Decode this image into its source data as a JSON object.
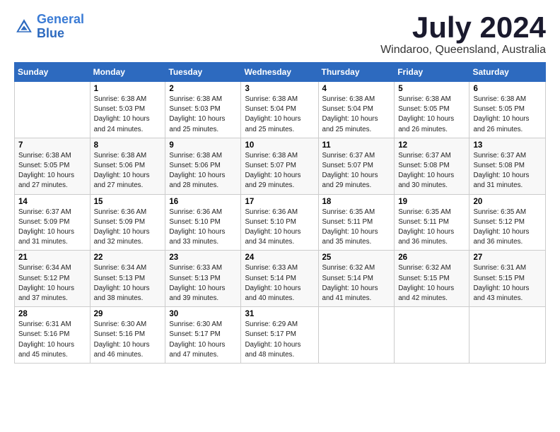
{
  "logo": {
    "text_general": "General",
    "text_blue": "Blue"
  },
  "header": {
    "title": "July 2024",
    "subtitle": "Windaroo, Queensland, Australia"
  },
  "days_of_week": [
    "Sunday",
    "Monday",
    "Tuesday",
    "Wednesday",
    "Thursday",
    "Friday",
    "Saturday"
  ],
  "weeks": [
    [
      {
        "day": "",
        "info": ""
      },
      {
        "day": "1",
        "info": "Sunrise: 6:38 AM\nSunset: 5:03 PM\nDaylight: 10 hours\nand 24 minutes."
      },
      {
        "day": "2",
        "info": "Sunrise: 6:38 AM\nSunset: 5:03 PM\nDaylight: 10 hours\nand 25 minutes."
      },
      {
        "day": "3",
        "info": "Sunrise: 6:38 AM\nSunset: 5:04 PM\nDaylight: 10 hours\nand 25 minutes."
      },
      {
        "day": "4",
        "info": "Sunrise: 6:38 AM\nSunset: 5:04 PM\nDaylight: 10 hours\nand 25 minutes."
      },
      {
        "day": "5",
        "info": "Sunrise: 6:38 AM\nSunset: 5:05 PM\nDaylight: 10 hours\nand 26 minutes."
      },
      {
        "day": "6",
        "info": "Sunrise: 6:38 AM\nSunset: 5:05 PM\nDaylight: 10 hours\nand 26 minutes."
      }
    ],
    [
      {
        "day": "7",
        "info": "Sunrise: 6:38 AM\nSunset: 5:05 PM\nDaylight: 10 hours\nand 27 minutes."
      },
      {
        "day": "8",
        "info": "Sunrise: 6:38 AM\nSunset: 5:06 PM\nDaylight: 10 hours\nand 27 minutes."
      },
      {
        "day": "9",
        "info": "Sunrise: 6:38 AM\nSunset: 5:06 PM\nDaylight: 10 hours\nand 28 minutes."
      },
      {
        "day": "10",
        "info": "Sunrise: 6:38 AM\nSunset: 5:07 PM\nDaylight: 10 hours\nand 29 minutes."
      },
      {
        "day": "11",
        "info": "Sunrise: 6:37 AM\nSunset: 5:07 PM\nDaylight: 10 hours\nand 29 minutes."
      },
      {
        "day": "12",
        "info": "Sunrise: 6:37 AM\nSunset: 5:08 PM\nDaylight: 10 hours\nand 30 minutes."
      },
      {
        "day": "13",
        "info": "Sunrise: 6:37 AM\nSunset: 5:08 PM\nDaylight: 10 hours\nand 31 minutes."
      }
    ],
    [
      {
        "day": "14",
        "info": "Sunrise: 6:37 AM\nSunset: 5:09 PM\nDaylight: 10 hours\nand 31 minutes."
      },
      {
        "day": "15",
        "info": "Sunrise: 6:36 AM\nSunset: 5:09 PM\nDaylight: 10 hours\nand 32 minutes."
      },
      {
        "day": "16",
        "info": "Sunrise: 6:36 AM\nSunset: 5:10 PM\nDaylight: 10 hours\nand 33 minutes."
      },
      {
        "day": "17",
        "info": "Sunrise: 6:36 AM\nSunset: 5:10 PM\nDaylight: 10 hours\nand 34 minutes."
      },
      {
        "day": "18",
        "info": "Sunrise: 6:35 AM\nSunset: 5:11 PM\nDaylight: 10 hours\nand 35 minutes."
      },
      {
        "day": "19",
        "info": "Sunrise: 6:35 AM\nSunset: 5:11 PM\nDaylight: 10 hours\nand 36 minutes."
      },
      {
        "day": "20",
        "info": "Sunrise: 6:35 AM\nSunset: 5:12 PM\nDaylight: 10 hours\nand 36 minutes."
      }
    ],
    [
      {
        "day": "21",
        "info": "Sunrise: 6:34 AM\nSunset: 5:12 PM\nDaylight: 10 hours\nand 37 minutes."
      },
      {
        "day": "22",
        "info": "Sunrise: 6:34 AM\nSunset: 5:13 PM\nDaylight: 10 hours\nand 38 minutes."
      },
      {
        "day": "23",
        "info": "Sunrise: 6:33 AM\nSunset: 5:13 PM\nDaylight: 10 hours\nand 39 minutes."
      },
      {
        "day": "24",
        "info": "Sunrise: 6:33 AM\nSunset: 5:14 PM\nDaylight: 10 hours\nand 40 minutes."
      },
      {
        "day": "25",
        "info": "Sunrise: 6:32 AM\nSunset: 5:14 PM\nDaylight: 10 hours\nand 41 minutes."
      },
      {
        "day": "26",
        "info": "Sunrise: 6:32 AM\nSunset: 5:15 PM\nDaylight: 10 hours\nand 42 minutes."
      },
      {
        "day": "27",
        "info": "Sunrise: 6:31 AM\nSunset: 5:15 PM\nDaylight: 10 hours\nand 43 minutes."
      }
    ],
    [
      {
        "day": "28",
        "info": "Sunrise: 6:31 AM\nSunset: 5:16 PM\nDaylight: 10 hours\nand 45 minutes."
      },
      {
        "day": "29",
        "info": "Sunrise: 6:30 AM\nSunset: 5:16 PM\nDaylight: 10 hours\nand 46 minutes."
      },
      {
        "day": "30",
        "info": "Sunrise: 6:30 AM\nSunset: 5:17 PM\nDaylight: 10 hours\nand 47 minutes."
      },
      {
        "day": "31",
        "info": "Sunrise: 6:29 AM\nSunset: 5:17 PM\nDaylight: 10 hours\nand 48 minutes."
      },
      {
        "day": "",
        "info": ""
      },
      {
        "day": "",
        "info": ""
      },
      {
        "day": "",
        "info": ""
      }
    ]
  ]
}
